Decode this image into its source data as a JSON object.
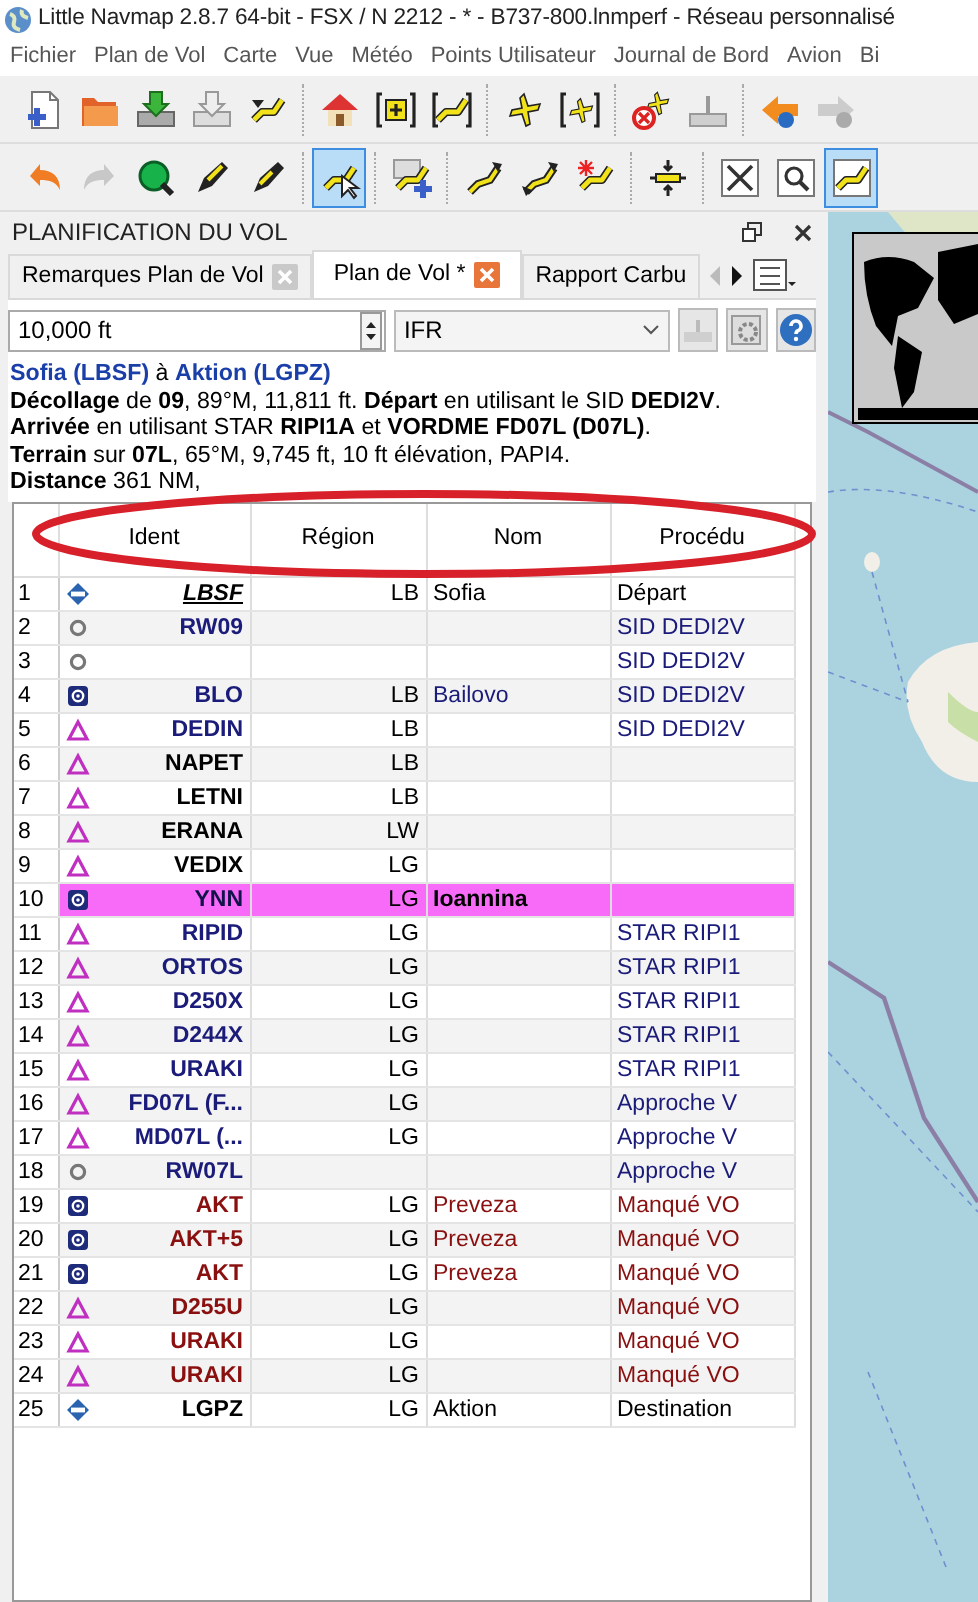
{
  "window": {
    "title": "Little Navmap 2.8.7 64-bit - FSX / N 2212 - * - B737-800.lnmperf - Réseau personnalisé"
  },
  "menu": [
    "Fichier",
    "Plan de Vol",
    "Carte",
    "Vue",
    "Météo",
    "Points Utilisateur",
    "Journal de Bord",
    "Avion",
    "Bi"
  ],
  "toolbar_1": [
    [
      {
        "kind": "new-file"
      },
      {
        "kind": "folder"
      },
      {
        "kind": "drive-save"
      },
      {
        "kind": "drive-grey"
      },
      {
        "kind": "route-arrow"
      }
    ],
    [
      {
        "kind": "home"
      },
      {
        "kind": "bracket-plus"
      },
      {
        "kind": "bracket-route"
      }
    ],
    [
      {
        "kind": "airplane"
      },
      {
        "kind": "airplane-bracket"
      }
    ],
    [
      {
        "kind": "airplane-stop"
      },
      {
        "kind": "tray"
      }
    ],
    [
      {
        "kind": "globe-back"
      },
      {
        "kind": "globe-forward"
      }
    ]
  ],
  "toolbar_2": [
    [
      {
        "kind": "undo",
        "pressed": false
      },
      {
        "kind": "redo",
        "pressed": false
      },
      {
        "kind": "magnifier",
        "pressed": false
      },
      {
        "kind": "pencil-up",
        "pressed": false
      },
      {
        "kind": "pencil-down",
        "pressed": false
      }
    ],
    [
      {
        "kind": "route-cursor",
        "pressed": true
      }
    ],
    [
      {
        "kind": "route-plus",
        "pressed": false
      }
    ],
    [
      {
        "kind": "link",
        "pressed": false
      },
      {
        "kind": "link-both",
        "pressed": false
      },
      {
        "kind": "route-star",
        "pressed": false
      }
    ],
    [
      {
        "kind": "split",
        "pressed": false
      }
    ],
    [
      {
        "kind": "fit",
        "pressed": false
      },
      {
        "kind": "zoom-window",
        "pressed": false
      },
      {
        "kind": "route-window",
        "pressed": true
      }
    ]
  ],
  "panel": {
    "title": "PLANIFICATION DU VOL"
  },
  "tabs": [
    {
      "label": "Remarques Plan de Vol",
      "selected": false
    },
    {
      "label": "Plan de Vol *",
      "selected": true
    },
    {
      "label": "Rapport Carbu",
      "selected": false
    }
  ],
  "altitude": {
    "value": "10,000 ft"
  },
  "flight_rules": {
    "value": "IFR"
  },
  "summary": [
    {
      "kind": "route",
      "text": "**Sofia (LBSF)** à **Aktion (LGPZ)**"
    },
    {
      "kind": "plain",
      "text": "**Décollage** de **09**, 89°M, 11,811 ft. **Départ** en utilisant le SID **DEDI2V**."
    },
    {
      "kind": "plain",
      "text": "**Arrivée** en utilisant STAR **RIPI1A** et **VORDME FD07L (D07L)**."
    },
    {
      "kind": "plain",
      "text": "**Terrain** sur **07L**, 65°M, 9,745 ft, 10 ft élévation, PAPI4."
    },
    {
      "kind": "plain",
      "text": "**Distance** 361 NM,"
    }
  ],
  "table": {
    "columns": [
      "Ident",
      "Région",
      "Nom",
      "Procédu"
    ],
    "rows": [
      {
        "number": "1",
        "kind": "departure",
        "ident": "LBSF",
        "region": "LB",
        "name": "Sofia",
        "procedure": "Départ",
        "color": "#000000",
        "selected": false
      },
      {
        "number": "2",
        "kind": "runway",
        "ident": "RW09",
        "region": "",
        "name": "",
        "procedure": "SID DEDI2V",
        "color": "#1b1b7a",
        "selected": false
      },
      {
        "number": "3",
        "kind": "runway",
        "ident": "",
        "region": "",
        "name": "",
        "procedure": "SID DEDI2V",
        "color": "#1b1b7a",
        "selected": false
      },
      {
        "number": "4",
        "kind": "vor",
        "ident": "BLO",
        "region": "LB",
        "name": "Bailovo",
        "procedure": "SID DEDI2V",
        "color": "#1b1b7a",
        "selected": false
      },
      {
        "number": "5",
        "kind": "waypoint",
        "ident": "DEDIN",
        "region": "LB",
        "name": "",
        "procedure": "SID DEDI2V",
        "color": "#1b1b7a",
        "selected": false
      },
      {
        "number": "6",
        "kind": "waypoint",
        "ident": "NAPET",
        "region": "LB",
        "name": "",
        "procedure": "",
        "color": "#000000",
        "selected": false
      },
      {
        "number": "7",
        "kind": "waypoint",
        "ident": "LETNI",
        "region": "LB",
        "name": "",
        "procedure": "",
        "color": "#000000",
        "selected": false
      },
      {
        "number": "8",
        "kind": "waypoint",
        "ident": "ERANA",
        "region": "LW",
        "name": "",
        "procedure": "",
        "color": "#000000",
        "selected": false
      },
      {
        "number": "9",
        "kind": "waypoint",
        "ident": "VEDIX",
        "region": "LG",
        "name": "",
        "procedure": "",
        "color": "#000000",
        "selected": false
      },
      {
        "number": "10",
        "kind": "vor",
        "ident": "YNN",
        "region": "LG",
        "name": "Ioannina",
        "procedure": "",
        "selected": true
      },
      {
        "number": "11",
        "kind": "waypoint",
        "ident": "RIPID",
        "region": "LG",
        "name": "",
        "procedure": "STAR RIPI1",
        "color": "#1b1b7a",
        "selected": false
      },
      {
        "number": "12",
        "kind": "waypoint",
        "ident": "ORTOS",
        "region": "LG",
        "name": "",
        "procedure": "STAR RIPI1",
        "color": "#1b1b7a",
        "selected": false
      },
      {
        "number": "13",
        "kind": "waypoint",
        "ident": "D250X",
        "region": "LG",
        "name": "",
        "procedure": "STAR RIPI1",
        "color": "#1b1b7a",
        "selected": false
      },
      {
        "number": "14",
        "kind": "waypoint",
        "ident": "D244X",
        "region": "LG",
        "name": "",
        "procedure": "STAR RIPI1",
        "color": "#1b1b7a",
        "selected": false
      },
      {
        "number": "15",
        "kind": "waypoint",
        "ident": "URAKI",
        "region": "LG",
        "name": "",
        "procedure": "STAR RIPI1",
        "color": "#1b1b7a",
        "selected": false
      },
      {
        "number": "16",
        "kind": "waypoint",
        "ident": "FD07L (F...",
        "region": "LG",
        "name": "",
        "procedure": "Approche V",
        "color": "#1b1b7a",
        "selected": false
      },
      {
        "number": "17",
        "kind": "waypoint",
        "ident": "MD07L (...",
        "region": "LG",
        "name": "",
        "procedure": "Approche V",
        "color": "#1b1b7a",
        "selected": false
      },
      {
        "number": "18",
        "kind": "runway",
        "ident": "RW07L",
        "region": "",
        "name": "",
        "procedure": "Approche V",
        "color": "#1b1b7a",
        "selected": false
      },
      {
        "number": "19",
        "kind": "vor",
        "ident": "AKT",
        "region": "LG",
        "name": "Preveza",
        "procedure": "Manqué VO",
        "color": "#8a1010",
        "selected": false
      },
      {
        "number": "20",
        "kind": "vor",
        "ident": "AKT+5",
        "region": "LG",
        "name": "Preveza",
        "procedure": "Manqué VO",
        "color": "#8a1010",
        "selected": false
      },
      {
        "number": "21",
        "kind": "vor",
        "ident": "AKT",
        "region": "LG",
        "name": "Preveza",
        "procedure": "Manqué VO",
        "color": "#8a1010",
        "selected": false
      },
      {
        "number": "22",
        "kind": "waypoint",
        "ident": "D255U",
        "region": "LG",
        "name": "",
        "procedure": "Manqué VO",
        "color": "#8a1010",
        "selected": false
      },
      {
        "number": "23",
        "kind": "waypoint",
        "ident": "URAKI",
        "region": "LG",
        "name": "",
        "procedure": "Manqué VO",
        "color": "#8a1010",
        "selected": false
      },
      {
        "number": "24",
        "kind": "waypoint",
        "ident": "URAKI",
        "region": "LG",
        "name": "",
        "procedure": "Manqué VO",
        "color": "#8a1010",
        "selected": false
      },
      {
        "number": "25",
        "kind": "destination",
        "ident": "LGPZ",
        "region": "LG",
        "name": "Aktion",
        "procedure": "Destination",
        "color": "#000000",
        "selected": false
      }
    ]
  },
  "map": {
    "kind": "picture"
  }
}
